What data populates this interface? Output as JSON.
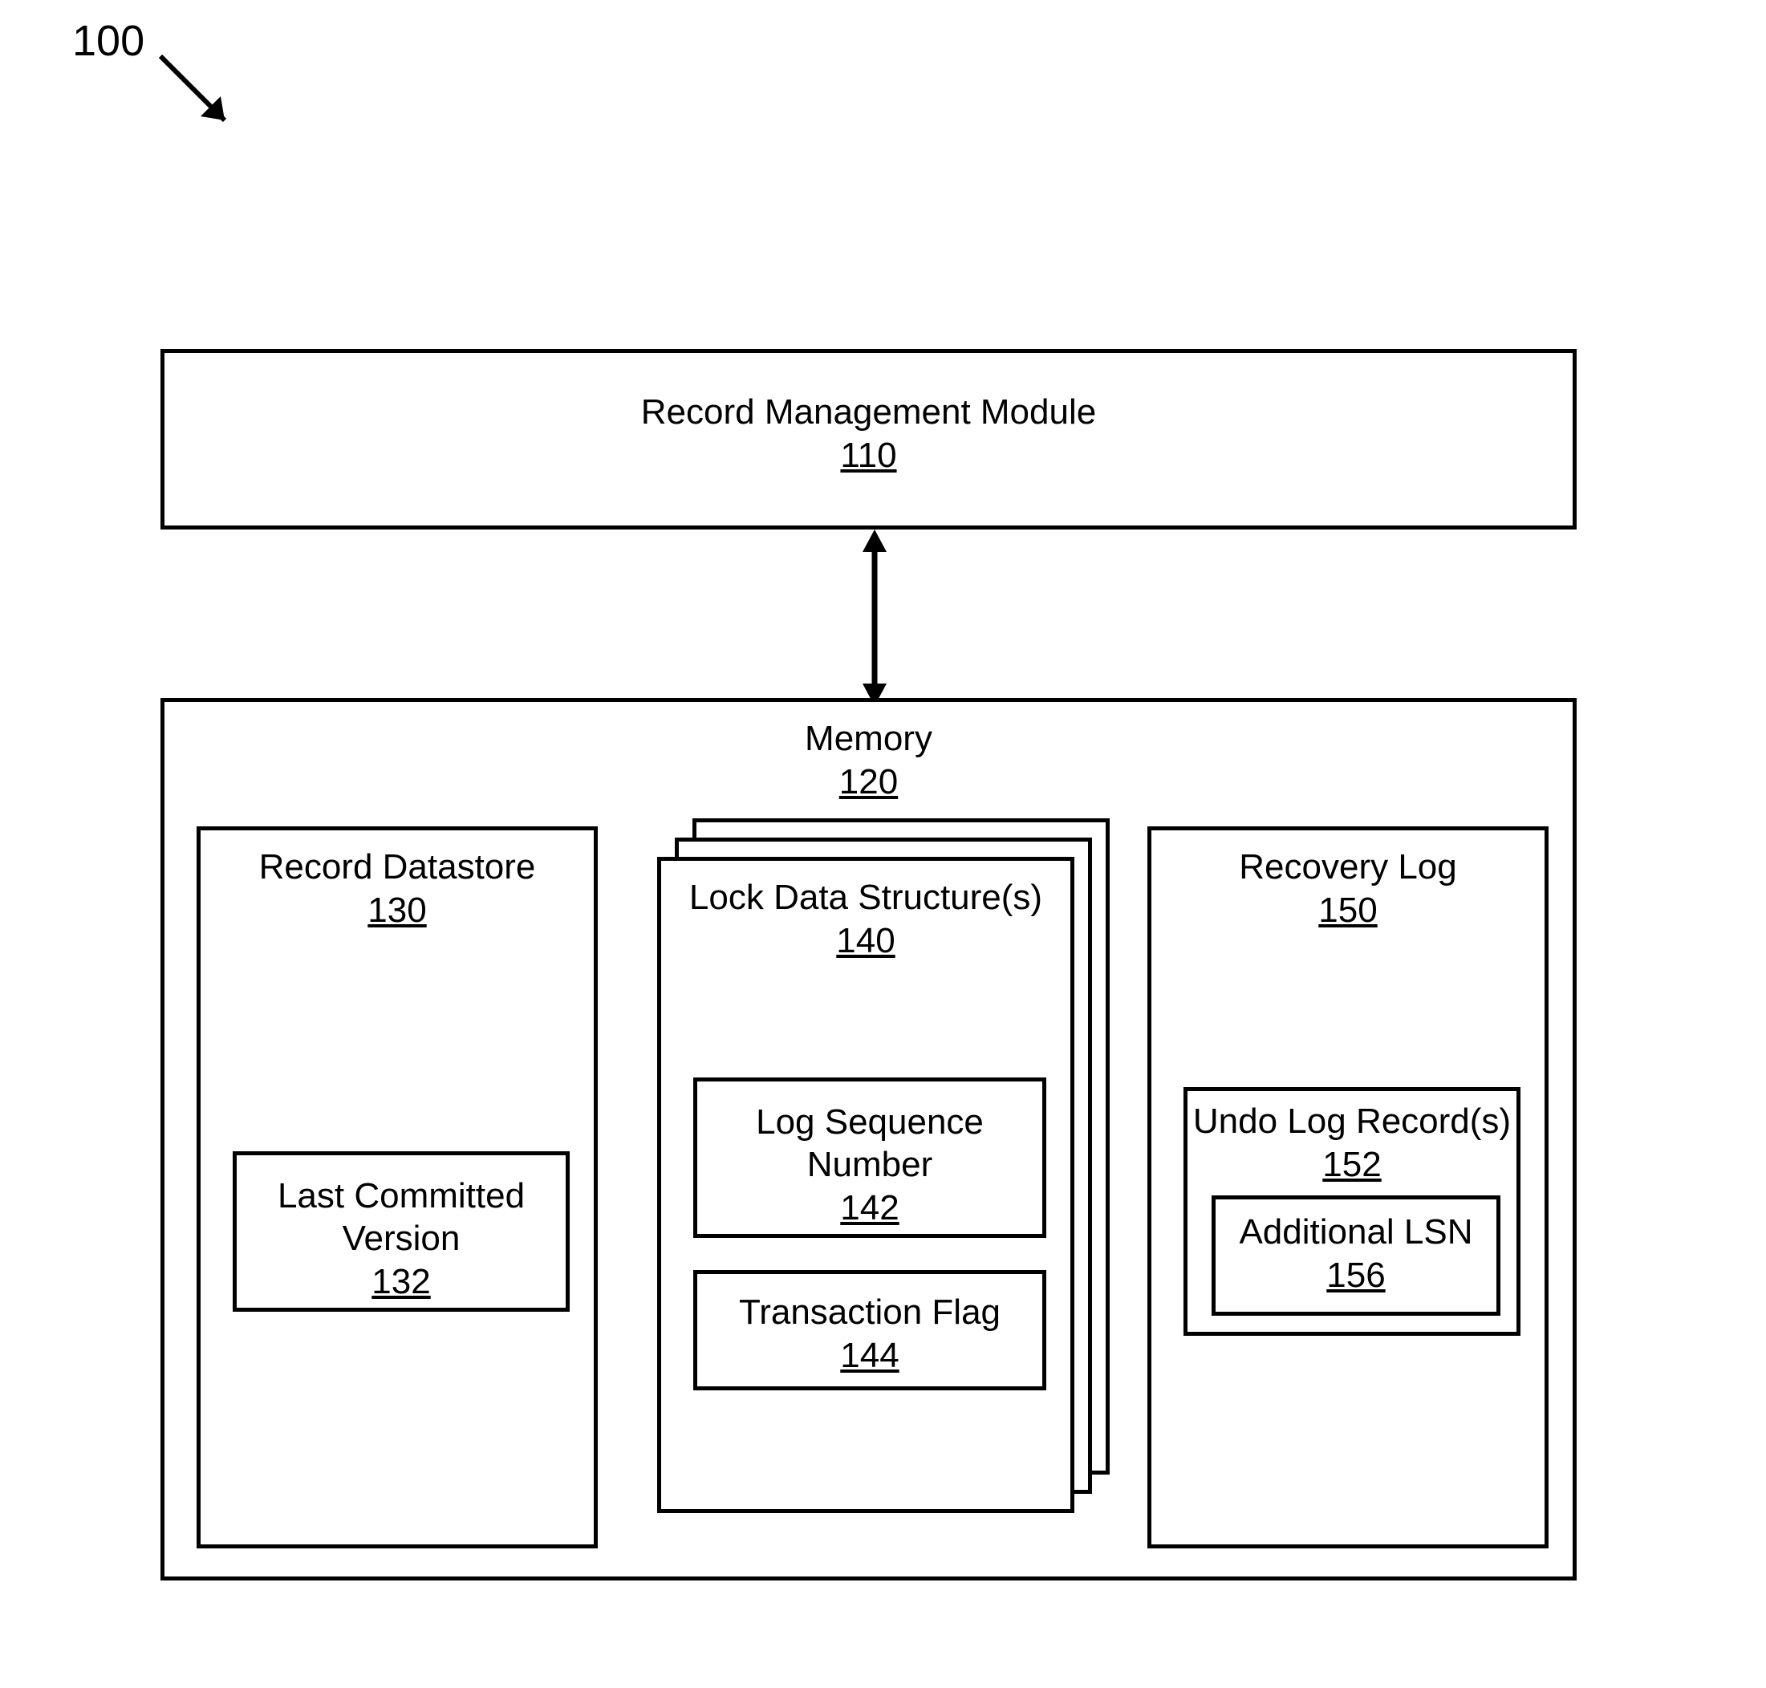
{
  "figure_ref": "100",
  "record_management": {
    "title": "Record Management Module",
    "ref": "110"
  },
  "memory": {
    "title": "Memory",
    "ref": "120",
    "record_datastore": {
      "title": "Record Datastore",
      "ref": "130",
      "last_committed_version": {
        "title": "Last Committed Version",
        "ref": "132"
      }
    },
    "lock_data": {
      "title": "Lock Data Structure(s)",
      "ref": "140",
      "log_sequence_number": {
        "title": "Log Sequence Number",
        "ref": "142"
      },
      "transaction_flag": {
        "title": "Transaction Flag",
        "ref": "144"
      }
    },
    "recovery_log": {
      "title": "Recovery Log",
      "ref": "150",
      "undo_log_records": {
        "title": "Undo Log Record(s)",
        "ref": "152",
        "additional_lsn": {
          "title": "Additional LSN",
          "ref": "156"
        }
      }
    }
  }
}
